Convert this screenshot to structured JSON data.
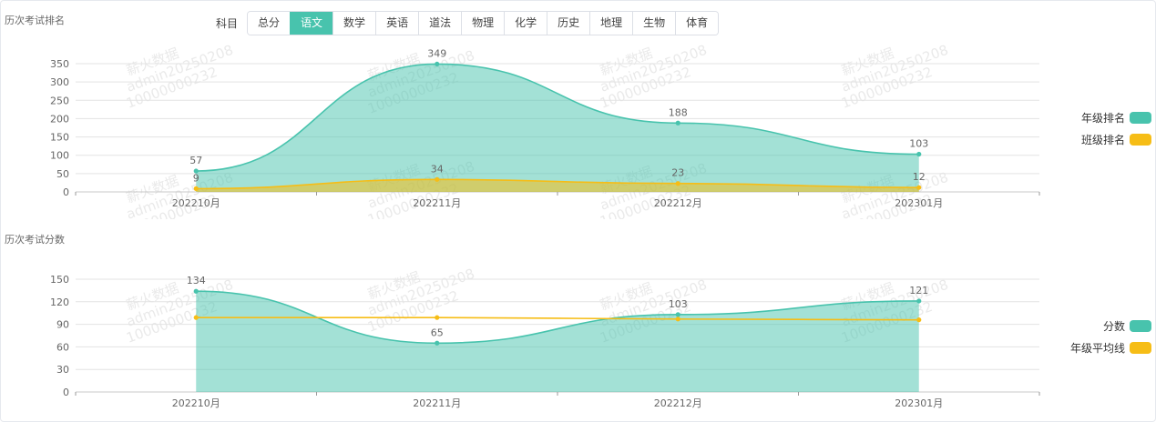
{
  "subject_filter": {
    "label": "科目",
    "tabs": [
      "总分",
      "语文",
      "数学",
      "英语",
      "道法",
      "物理",
      "化学",
      "历史",
      "地理",
      "生物",
      "体育"
    ],
    "active_index": 1
  },
  "watermark": [
    "薪火数据",
    "admin20250208",
    "10000000232"
  ],
  "colors": {
    "teal": "#48c3ad",
    "teal_fill": "#a1e0d6",
    "yellow": "#f6bd16"
  },
  "chart_data": [
    {
      "type": "area",
      "title": "历次考试排名",
      "categories": [
        "202210月",
        "202211月",
        "202212月",
        "202301月"
      ],
      "ylim": [
        0,
        350
      ],
      "yticks": [
        0,
        50,
        100,
        150,
        200,
        250,
        300,
        350
      ],
      "grid": true,
      "legend_position": "right",
      "series": [
        {
          "name": "年级排名",
          "values": [
            57,
            349,
            188,
            103
          ],
          "color": "#48c3ad",
          "area": true
        },
        {
          "name": "班级排名",
          "values": [
            9,
            34,
            23,
            12
          ],
          "color": "#f6bd16",
          "area": true
        }
      ]
    },
    {
      "type": "area",
      "title": "历次考试分数",
      "categories": [
        "202210月",
        "202211月",
        "202212月",
        "202301月"
      ],
      "ylim": [
        0,
        150
      ],
      "yticks": [
        0,
        30,
        60,
        90,
        120,
        150
      ],
      "grid": true,
      "legend_position": "right",
      "series": [
        {
          "name": "分数",
          "values": [
            134,
            65,
            103,
            121
          ],
          "color": "#48c3ad",
          "area": true,
          "labels": true
        },
        {
          "name": "年级平均线",
          "values": [
            99,
            99,
            97,
            96
          ],
          "color": "#f6bd16",
          "area": false,
          "labels": false
        }
      ]
    }
  ]
}
